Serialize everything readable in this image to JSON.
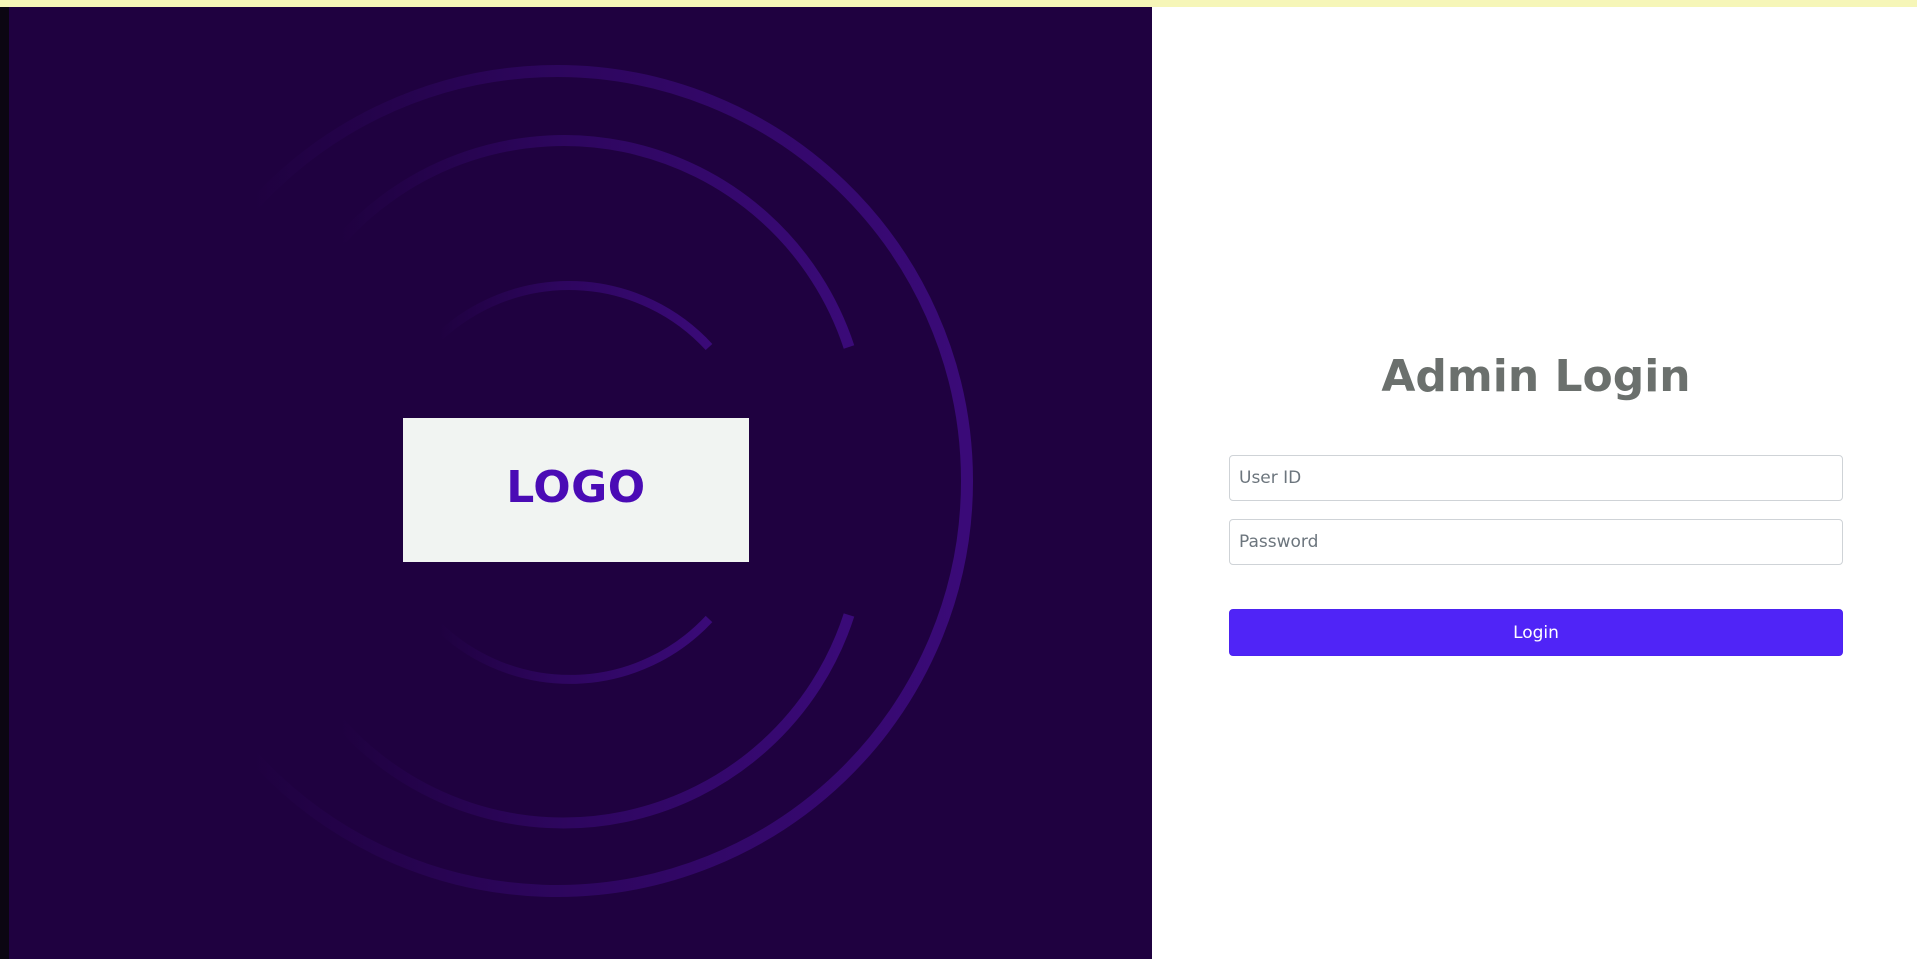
{
  "brand": {
    "logo_text": "LOGO"
  },
  "login": {
    "title": "Admin Login",
    "user_id_placeholder": "User ID",
    "password_placeholder": "Password",
    "submit_label": "Login"
  },
  "colors": {
    "left_background": "#1f0140",
    "arc_color": "#3a0a78",
    "logo_background": "#f1f4f2",
    "logo_text": "#4a0bb5",
    "title_text": "#6b706d",
    "button_background": "#5024f7",
    "top_strip": "#f6f6b8"
  }
}
